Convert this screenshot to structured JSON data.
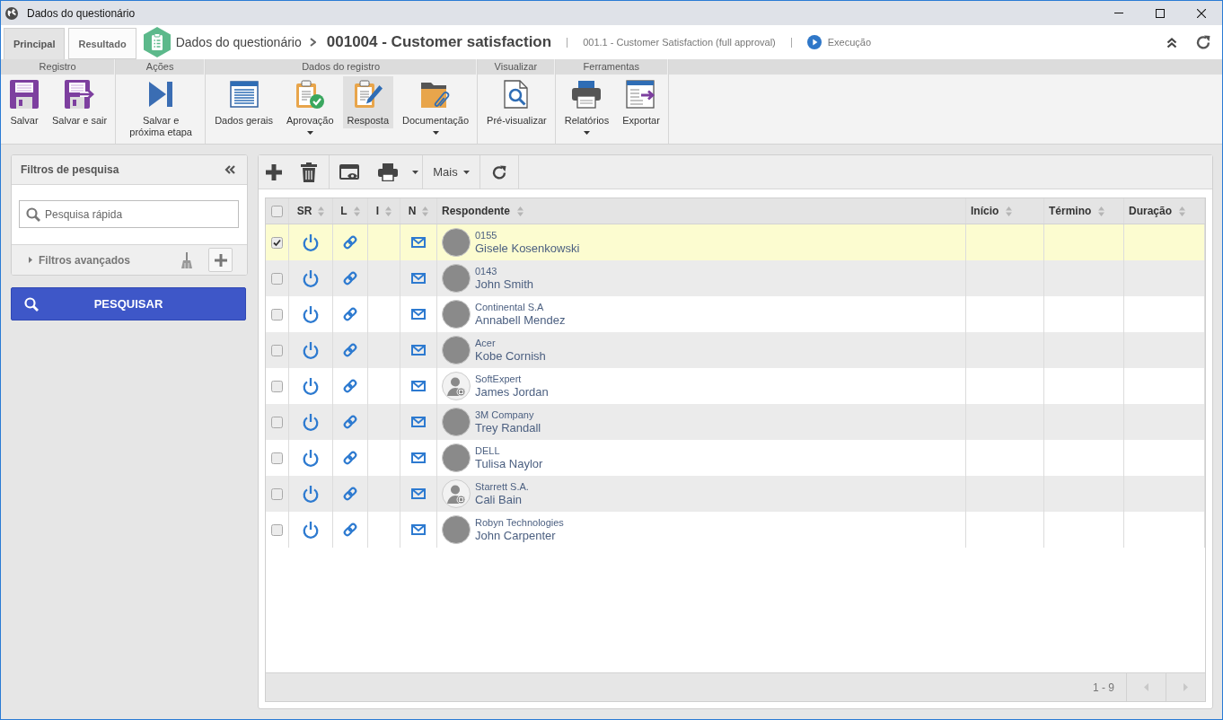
{
  "window": {
    "title": "Dados do questionário"
  },
  "header": {
    "tabs": [
      {
        "label": "Principal",
        "selected": true
      },
      {
        "label": "Resultado",
        "selected": false
      }
    ],
    "breadcrumb": "Dados do questionário",
    "title": "001004 - Customer satisfaction",
    "revision": "001.1 - Customer Satisfaction (full approval)",
    "status": "Execução"
  },
  "ribbon": {
    "groups": [
      {
        "title": "Registro",
        "buttons": [
          {
            "kind": "save",
            "label": "Salvar",
            "menu": false,
            "selected": false
          },
          {
            "kind": "exit",
            "label": "Salvar e sair",
            "menu": false,
            "selected": false
          }
        ]
      },
      {
        "title": "Ações",
        "buttons": [
          {
            "kind": "next",
            "label": "Salvar e próxima etapa",
            "menu": false,
            "selected": false
          }
        ]
      },
      {
        "title": "Dados do registro",
        "buttons": [
          {
            "kind": "form",
            "label": "Dados gerais",
            "menu": false,
            "selected": false
          },
          {
            "kind": "approval",
            "label": "Aprovação",
            "menu": true,
            "selected": false
          },
          {
            "kind": "answer",
            "label": "Resposta",
            "menu": false,
            "selected": true
          },
          {
            "kind": "documents",
            "label": "Documentação",
            "menu": true,
            "selected": false
          }
        ]
      },
      {
        "title": "Visualizar",
        "buttons": [
          {
            "kind": "preview",
            "label": "Pré-visualizar",
            "menu": false,
            "selected": false
          }
        ]
      },
      {
        "title": "Ferramentas",
        "buttons": [
          {
            "kind": "reports",
            "label": "Relatórios",
            "menu": true,
            "selected": false
          },
          {
            "kind": "export",
            "label": "Exportar",
            "menu": false,
            "selected": false
          }
        ]
      }
    ]
  },
  "filters": {
    "title": "Filtros de pesquisa",
    "search": {
      "placeholder": "Pesquisa rápida"
    },
    "advanced": {
      "label": "Filtros avançados",
      "expanded": false
    },
    "search_button": "PESQUISAR"
  },
  "grid": {
    "toolbar": [
      {
        "buttons": [
          {
            "kind": "add"
          },
          {
            "kind": "delete"
          }
        ]
      },
      {
        "buttons": [
          {
            "kind": "view"
          },
          {
            "kind": "print"
          },
          {
            "kind": "dropdown"
          }
        ]
      },
      {
        "buttons": [
          {
            "kind": "more",
            "label": "Mais"
          }
        ]
      },
      {
        "buttons": [
          {
            "kind": "refresh"
          }
        ]
      }
    ],
    "select_all": {
      "checked": false
    },
    "columns": [
      "SR",
      "L",
      "I",
      "N",
      "Respondente",
      "Início",
      "Término",
      "Duração"
    ],
    "rows": [
      {
        "selected": true,
        "checked": true,
        "avatar": {
          "kind": "photo"
        },
        "company": "0155",
        "name": "Gisele Kosenkowski"
      },
      {
        "selected": false,
        "checked": false,
        "avatar": {
          "kind": "photo"
        },
        "company": "0143",
        "name": "John Smith"
      },
      {
        "selected": false,
        "checked": false,
        "avatar": {
          "kind": "photo"
        },
        "company": "Continental S.A",
        "name": "Annabell Mendez"
      },
      {
        "selected": false,
        "checked": false,
        "avatar": {
          "kind": "photo"
        },
        "company": "Acer",
        "name": "Kobe Cornish"
      },
      {
        "selected": false,
        "checked": false,
        "avatar": {
          "kind": "default"
        },
        "company": "SoftExpert",
        "name": "James Jordan"
      },
      {
        "selected": false,
        "checked": false,
        "avatar": {
          "kind": "photo"
        },
        "company": "3M Company",
        "name": "Trey Randall"
      },
      {
        "selected": false,
        "checked": false,
        "avatar": {
          "kind": "photo"
        },
        "company": "DELL",
        "name": "Tulisa Naylor"
      },
      {
        "selected": false,
        "checked": false,
        "avatar": {
          "kind": "default"
        },
        "company": "Starrett S.A.",
        "name": "Cali Bain"
      },
      {
        "selected": false,
        "checked": false,
        "avatar": {
          "kind": "photo"
        },
        "company": "Robyn Technologies",
        "name": "John Carpenter"
      }
    ],
    "pager": {
      "range": "1 - 9",
      "previous": {
        "disabled": true
      },
      "next": {
        "disabled": true
      }
    }
  }
}
